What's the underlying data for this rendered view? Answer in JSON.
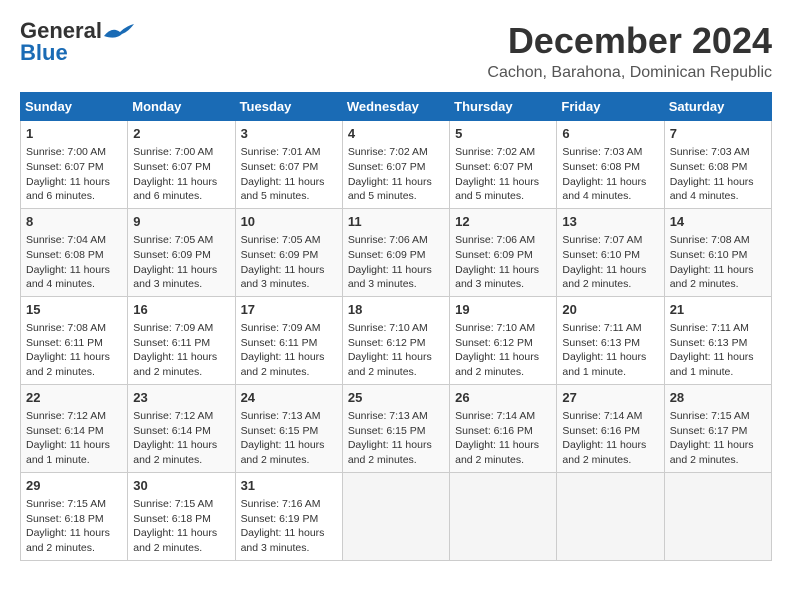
{
  "header": {
    "logo_general": "General",
    "logo_blue": "Blue",
    "month_title": "December 2024",
    "location": "Cachon, Barahona, Dominican Republic"
  },
  "calendar": {
    "days_of_week": [
      "Sunday",
      "Monday",
      "Tuesday",
      "Wednesday",
      "Thursday",
      "Friday",
      "Saturday"
    ],
    "weeks": [
      [
        null,
        null,
        null,
        null,
        null,
        null,
        null
      ]
    ],
    "cells": [
      {
        "day": null,
        "empty": true
      },
      {
        "day": null,
        "empty": true
      },
      {
        "day": null,
        "empty": true
      },
      {
        "day": null,
        "empty": true
      },
      {
        "day": null,
        "empty": true
      },
      {
        "day": null,
        "empty": true
      },
      {
        "day": null,
        "empty": true
      }
    ],
    "rows": [
      [
        {
          "day": "1",
          "sunrise": "7:00 AM",
          "sunset": "6:07 PM",
          "daylight": "11 hours and 6 minutes.",
          "empty": false
        },
        {
          "day": "2",
          "sunrise": "7:00 AM",
          "sunset": "6:07 PM",
          "daylight": "11 hours and 6 minutes.",
          "empty": false
        },
        {
          "day": "3",
          "sunrise": "7:01 AM",
          "sunset": "6:07 PM",
          "daylight": "11 hours and 5 minutes.",
          "empty": false
        },
        {
          "day": "4",
          "sunrise": "7:02 AM",
          "sunset": "6:07 PM",
          "daylight": "11 hours and 5 minutes.",
          "empty": false
        },
        {
          "day": "5",
          "sunrise": "7:02 AM",
          "sunset": "6:07 PM",
          "daylight": "11 hours and 5 minutes.",
          "empty": false
        },
        {
          "day": "6",
          "sunrise": "7:03 AM",
          "sunset": "6:08 PM",
          "daylight": "11 hours and 4 minutes.",
          "empty": false
        },
        {
          "day": "7",
          "sunrise": "7:03 AM",
          "sunset": "6:08 PM",
          "daylight": "11 hours and 4 minutes.",
          "empty": false
        }
      ],
      [
        {
          "day": "8",
          "sunrise": "7:04 AM",
          "sunset": "6:08 PM",
          "daylight": "11 hours and 4 minutes.",
          "empty": false
        },
        {
          "day": "9",
          "sunrise": "7:05 AM",
          "sunset": "6:09 PM",
          "daylight": "11 hours and 3 minutes.",
          "empty": false
        },
        {
          "day": "10",
          "sunrise": "7:05 AM",
          "sunset": "6:09 PM",
          "daylight": "11 hours and 3 minutes.",
          "empty": false
        },
        {
          "day": "11",
          "sunrise": "7:06 AM",
          "sunset": "6:09 PM",
          "daylight": "11 hours and 3 minutes.",
          "empty": false
        },
        {
          "day": "12",
          "sunrise": "7:06 AM",
          "sunset": "6:09 PM",
          "daylight": "11 hours and 3 minutes.",
          "empty": false
        },
        {
          "day": "13",
          "sunrise": "7:07 AM",
          "sunset": "6:10 PM",
          "daylight": "11 hours and 2 minutes.",
          "empty": false
        },
        {
          "day": "14",
          "sunrise": "7:08 AM",
          "sunset": "6:10 PM",
          "daylight": "11 hours and 2 minutes.",
          "empty": false
        }
      ],
      [
        {
          "day": "15",
          "sunrise": "7:08 AM",
          "sunset": "6:11 PM",
          "daylight": "11 hours and 2 minutes.",
          "empty": false
        },
        {
          "day": "16",
          "sunrise": "7:09 AM",
          "sunset": "6:11 PM",
          "daylight": "11 hours and 2 minutes.",
          "empty": false
        },
        {
          "day": "17",
          "sunrise": "7:09 AM",
          "sunset": "6:11 PM",
          "daylight": "11 hours and 2 minutes.",
          "empty": false
        },
        {
          "day": "18",
          "sunrise": "7:10 AM",
          "sunset": "6:12 PM",
          "daylight": "11 hours and 2 minutes.",
          "empty": false
        },
        {
          "day": "19",
          "sunrise": "7:10 AM",
          "sunset": "6:12 PM",
          "daylight": "11 hours and 2 minutes.",
          "empty": false
        },
        {
          "day": "20",
          "sunrise": "7:11 AM",
          "sunset": "6:13 PM",
          "daylight": "11 hours and 1 minute.",
          "empty": false
        },
        {
          "day": "21",
          "sunrise": "7:11 AM",
          "sunset": "6:13 PM",
          "daylight": "11 hours and 1 minute.",
          "empty": false
        }
      ],
      [
        {
          "day": "22",
          "sunrise": "7:12 AM",
          "sunset": "6:14 PM",
          "daylight": "11 hours and 1 minute.",
          "empty": false
        },
        {
          "day": "23",
          "sunrise": "7:12 AM",
          "sunset": "6:14 PM",
          "daylight": "11 hours and 2 minutes.",
          "empty": false
        },
        {
          "day": "24",
          "sunrise": "7:13 AM",
          "sunset": "6:15 PM",
          "daylight": "11 hours and 2 minutes.",
          "empty": false
        },
        {
          "day": "25",
          "sunrise": "7:13 AM",
          "sunset": "6:15 PM",
          "daylight": "11 hours and 2 minutes.",
          "empty": false
        },
        {
          "day": "26",
          "sunrise": "7:14 AM",
          "sunset": "6:16 PM",
          "daylight": "11 hours and 2 minutes.",
          "empty": false
        },
        {
          "day": "27",
          "sunrise": "7:14 AM",
          "sunset": "6:16 PM",
          "daylight": "11 hours and 2 minutes.",
          "empty": false
        },
        {
          "day": "28",
          "sunrise": "7:15 AM",
          "sunset": "6:17 PM",
          "daylight": "11 hours and 2 minutes.",
          "empty": false
        }
      ],
      [
        {
          "day": "29",
          "sunrise": "7:15 AM",
          "sunset": "6:18 PM",
          "daylight": "11 hours and 2 minutes.",
          "empty": false
        },
        {
          "day": "30",
          "sunrise": "7:15 AM",
          "sunset": "6:18 PM",
          "daylight": "11 hours and 2 minutes.",
          "empty": false
        },
        {
          "day": "31",
          "sunrise": "7:16 AM",
          "sunset": "6:19 PM",
          "daylight": "11 hours and 3 minutes.",
          "empty": false
        },
        {
          "empty": true
        },
        {
          "empty": true
        },
        {
          "empty": true
        },
        {
          "empty": true
        }
      ]
    ]
  }
}
